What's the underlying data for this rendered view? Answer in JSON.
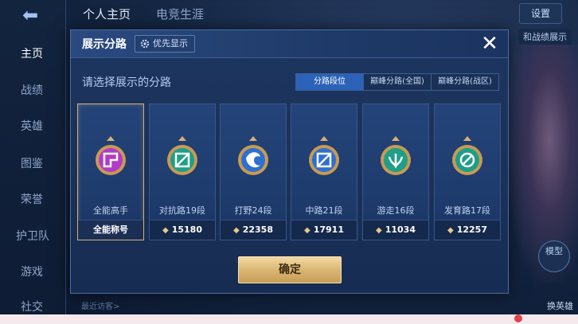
{
  "top_tabs": [
    "个人主页",
    "电竞生涯"
  ],
  "settings_label": "设置",
  "share_label": "和战绩展示",
  "left_nav": [
    "主页",
    "战绩",
    "英雄",
    "图鉴",
    "荣誉",
    "护卫队",
    "游戏",
    "社交"
  ],
  "right_side": {
    "model_label": "模型",
    "switch_hero_label": "换英雄"
  },
  "bottom_hint": "最近访客>",
  "modal": {
    "title": "展示分路",
    "priority_label": "优先显示",
    "close_icon": "close-icon",
    "prompt": "请选择展示的分路",
    "segments": [
      {
        "label": "分路段位",
        "active": true
      },
      {
        "label": "巅峰分路(全国)",
        "active": false
      },
      {
        "label": "巅峰分路(战区)",
        "active": false
      }
    ],
    "cards": [
      {
        "name": "全能高手",
        "footer": "全能称号",
        "score": "",
        "selected": true,
        "badge_color": "#b23bc6"
      },
      {
        "name": "对抗路19段",
        "footer": "",
        "score": "15180",
        "selected": false,
        "badge_color": "#1f9e88"
      },
      {
        "name": "打野24段",
        "footer": "",
        "score": "22358",
        "selected": false,
        "badge_color": "#2f6fcf"
      },
      {
        "name": "中路21段",
        "footer": "",
        "score": "17911",
        "selected": false,
        "badge_color": "#2f6fcf"
      },
      {
        "name": "游走16段",
        "footer": "",
        "score": "11034",
        "selected": false,
        "badge_color": "#1f9e88"
      },
      {
        "name": "发育路17段",
        "footer": "",
        "score": "12257",
        "selected": false,
        "badge_color": "#1f9e88"
      }
    ],
    "confirm_label": "确定"
  },
  "colors": {
    "accent_gold": "#d8b074",
    "active_segment": "#2c63b8",
    "panel_bg": "#1d3660"
  }
}
